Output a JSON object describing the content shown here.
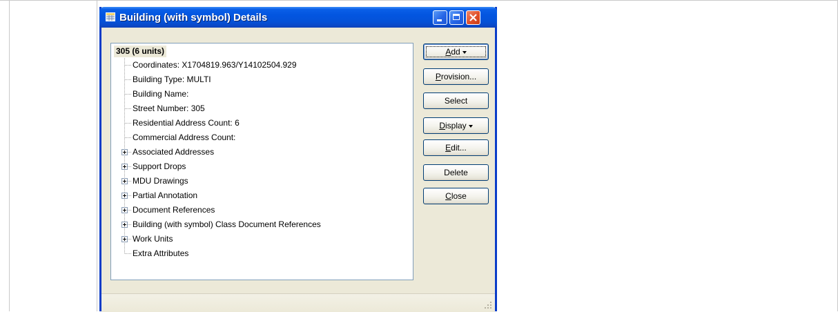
{
  "window": {
    "title": "Building (with symbol) Details",
    "title_icon": "grid-table-icon",
    "controls": [
      "minimize-icon",
      "maximize-icon",
      "close-icon"
    ]
  },
  "tree": {
    "root": "305 (6 units)",
    "items": [
      {
        "label": "Coordinates: X1704819.963/Y14102504.929",
        "expandable": false
      },
      {
        "label": "Building Type: MULTI",
        "expandable": false
      },
      {
        "label": "Building Name:",
        "expandable": false
      },
      {
        "label": "Street Number: 305",
        "expandable": false
      },
      {
        "label": "Residential Address Count: 6",
        "expandable": false
      },
      {
        "label": "Commercial Address Count:",
        "expandable": false
      },
      {
        "label": "Associated Addresses",
        "expandable": true
      },
      {
        "label": "Support Drops",
        "expandable": true
      },
      {
        "label": "MDU Drawings",
        "expandable": true
      },
      {
        "label": "Partial Annotation",
        "expandable": true
      },
      {
        "label": "Document References",
        "expandable": true
      },
      {
        "label": "Building (with symbol) Class Document References",
        "expandable": true
      },
      {
        "label": "Work Units",
        "expandable": true
      },
      {
        "label": "Extra Attributes",
        "expandable": false
      }
    ]
  },
  "buttons": {
    "add": {
      "mnemonic": "A",
      "rest": "dd"
    },
    "provision": {
      "mnemonic": "P",
      "rest": "rovision..."
    },
    "select": "Select",
    "display": {
      "mnemonic": "D",
      "rest": "isplay"
    },
    "edit": {
      "mnemonic": "E",
      "rest": "dit..."
    },
    "delete": "Delete",
    "close": {
      "mnemonic": "C",
      "rest": "lose"
    }
  },
  "colors": {
    "titlebar": "#0452d8",
    "window_bg": "#ece9d8",
    "close_button": "#e0502a"
  }
}
